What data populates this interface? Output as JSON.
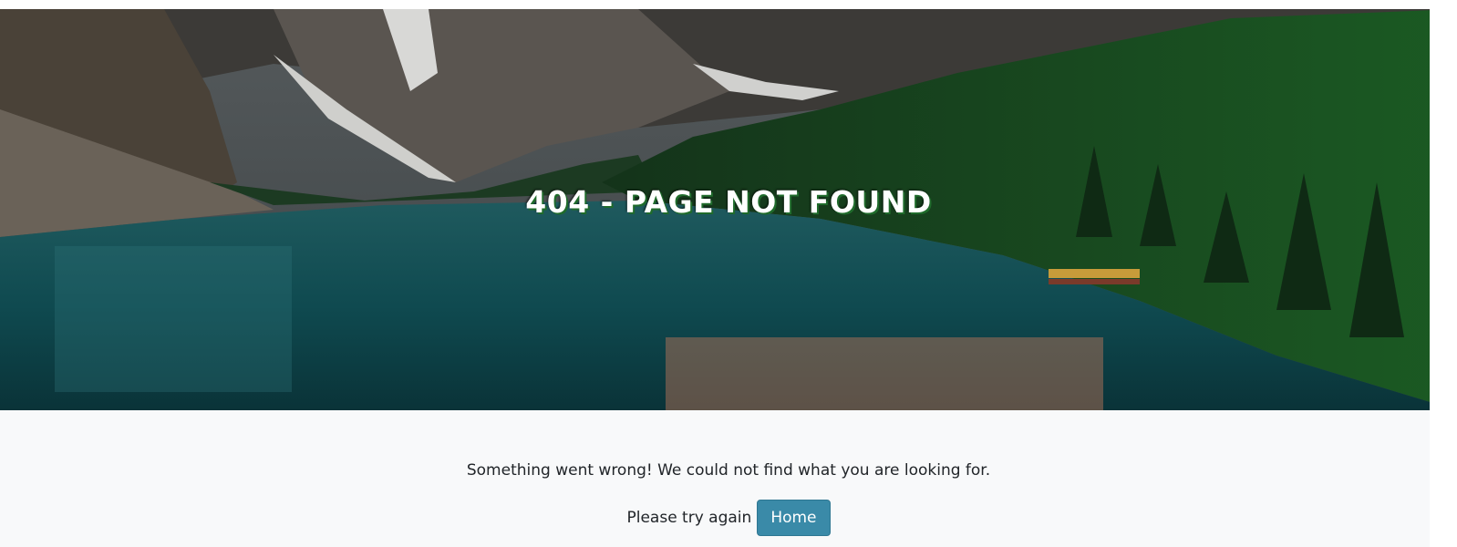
{
  "hero": {
    "title": "404 - PAGE NOT FOUND",
    "background_image": "mountain-lake-forest-landscape"
  },
  "content": {
    "message": "Something went wrong! We could not find what you are looking for.",
    "retry_text": "Please try again",
    "home_button_label": "Home"
  },
  "colors": {
    "page_background": "#f8f9fa",
    "button_background": "#3a8aa8",
    "title_color": "#ffffff",
    "title_shadow": "#1f6b2b"
  }
}
